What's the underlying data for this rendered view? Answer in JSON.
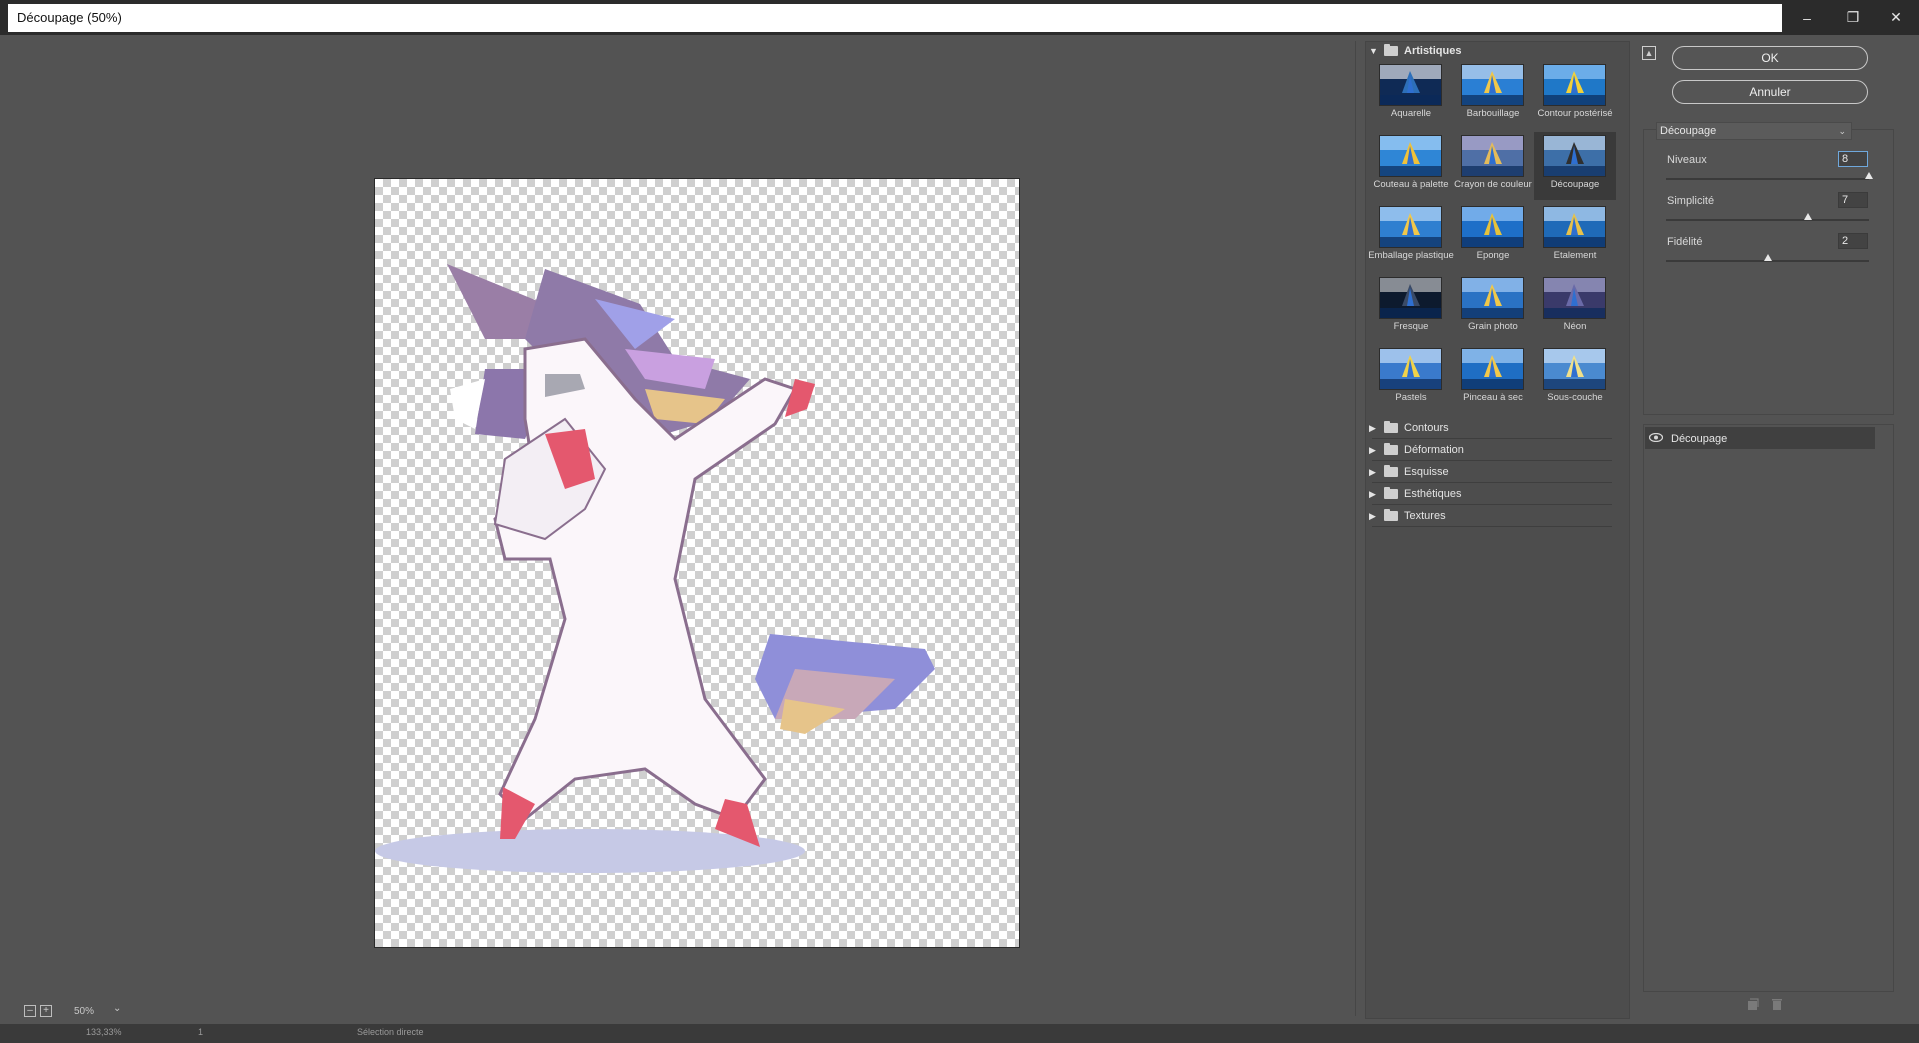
{
  "window": {
    "title": "Découpage (50%)",
    "controls": [
      "minimize-icon",
      "restore-icon",
      "close-icon"
    ]
  },
  "preview": {
    "zoom": "50%",
    "zoom_minus": "–",
    "zoom_plus": "+"
  },
  "status_bar": {
    "zoom": "133,33%",
    "page": "1",
    "tool": "Sélection directe"
  },
  "gallery": {
    "open_category": "Artistiques",
    "filters": [
      {
        "label": "Aquarelle"
      },
      {
        "label": "Barbouillage"
      },
      {
        "label": "Contour postérisé"
      },
      {
        "label": "Couteau à palette"
      },
      {
        "label": "Crayon de couleur"
      },
      {
        "label": "Découpage",
        "selected": true
      },
      {
        "label": "Emballage plastique"
      },
      {
        "label": "Eponge"
      },
      {
        "label": "Etalement"
      },
      {
        "label": "Fresque"
      },
      {
        "label": "Grain photo"
      },
      {
        "label": "Néon"
      },
      {
        "label": "Pastels"
      },
      {
        "label": "Pinceau à sec"
      },
      {
        "label": "Sous-couche"
      }
    ],
    "collapsed_categories": [
      "Contours",
      "Déformation",
      "Esquisse",
      "Esthétiques",
      "Textures"
    ]
  },
  "settings": {
    "ok_label": "OK",
    "cancel_label": "Annuler",
    "filter_select": "Découpage",
    "params": [
      {
        "label": "Niveaux",
        "value": "8",
        "min": 2,
        "max": 8
      },
      {
        "label": "Simplicité",
        "value": "7",
        "min": 0,
        "max": 10
      },
      {
        "label": "Fidélité",
        "value": "2",
        "min": 1,
        "max": 3
      }
    ],
    "layer_name": "Découpage"
  },
  "colors": {
    "accent_input": "#6fa8dc",
    "panel_bg": "#535353"
  }
}
